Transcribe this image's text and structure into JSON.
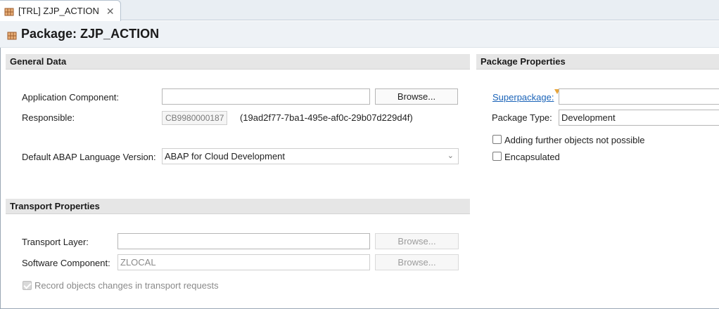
{
  "tab": {
    "label": "[TRL] ZJP_ACTION",
    "close_glyph": "✕"
  },
  "header": {
    "title": "Package: ZJP_ACTION"
  },
  "general": {
    "section_title": "General Data",
    "app_component_label": "Application Component:",
    "app_component_value": "",
    "browse_label": "Browse...",
    "responsible_label": "Responsible:",
    "responsible_user": "CB9980000187",
    "responsible_id": "(19ad2f77-7ba1-495e-af0c-29b07d229d4f)",
    "abap_version_label": "Default ABAP Language Version:",
    "abap_version_value": "ABAP for Cloud Development"
  },
  "transport": {
    "section_title": "Transport Properties",
    "layer_label": "Transport Layer:",
    "layer_value": "",
    "layer_browse": "Browse...",
    "software_label": "Software Component:",
    "software_value": "ZLOCAL",
    "software_browse": "Browse...",
    "record_label": "Record objects changes in transport requests",
    "record_checked": true
  },
  "package_props": {
    "section_title": "Package Properties",
    "superpackage_link": "Superpackage:",
    "superpackage_value": "",
    "package_type_label": "Package Type:",
    "package_type_value": "Development",
    "no_further_objects_label": "Adding further objects not possible",
    "encapsulated_label": "Encapsulated"
  },
  "colors": {
    "link": "#1a63b8",
    "required_marker": "#e8a53a",
    "section_bar": "#e6e6e6"
  },
  "icons": {
    "package": "package-icon",
    "close": "close-icon",
    "chevron": "chevron-down-icon"
  }
}
